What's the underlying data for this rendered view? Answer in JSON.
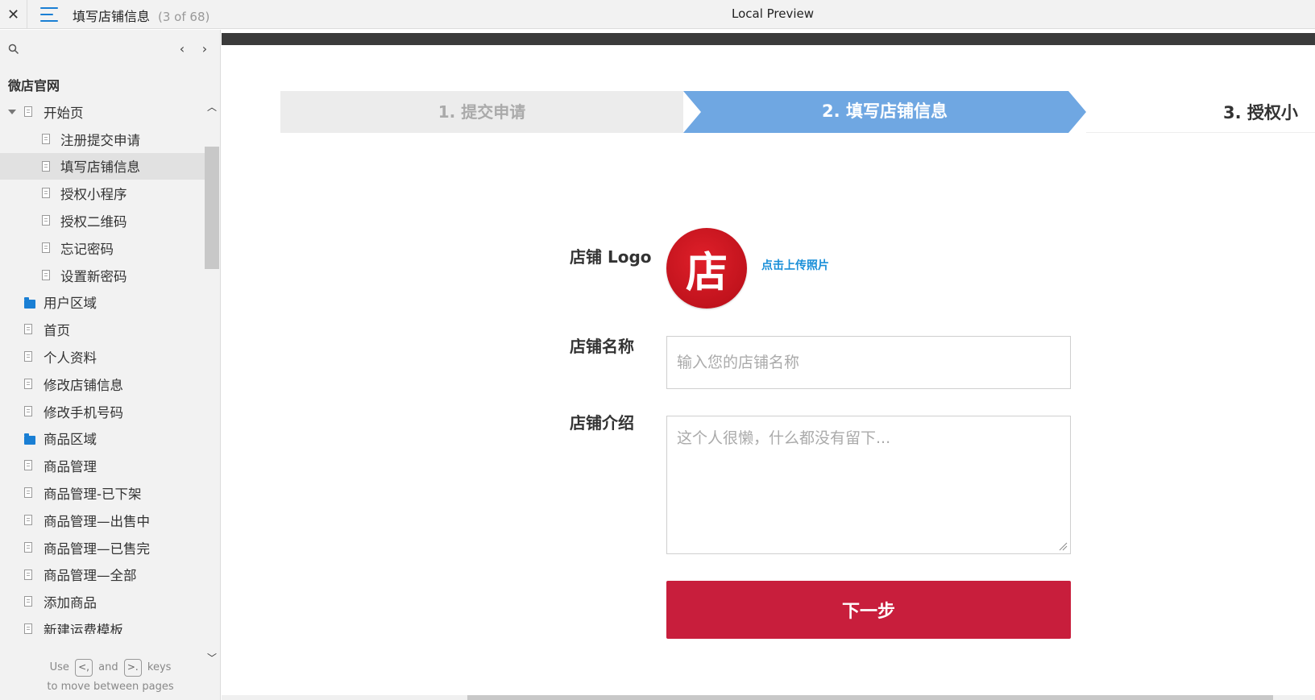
{
  "topbar": {
    "close_label": "✕",
    "title": "填写店铺信息",
    "count": "(3 of 68)",
    "preview_title": "Local Preview"
  },
  "sidebar": {
    "project_title": "微店官网",
    "items": [
      {
        "label": "开始页",
        "icon": "page-icon",
        "indent": 0,
        "caret": true
      },
      {
        "label": "注册提交申请",
        "icon": "page-icon",
        "indent": 1
      },
      {
        "label": "填写店铺信息",
        "icon": "page-icon",
        "indent": 1,
        "selected": true
      },
      {
        "label": "授权小程序",
        "icon": "page-icon",
        "indent": 1
      },
      {
        "label": "授权二维码",
        "icon": "page-icon",
        "indent": 1
      },
      {
        "label": "忘记密码",
        "icon": "page-icon",
        "indent": 1
      },
      {
        "label": "设置新密码",
        "icon": "page-icon",
        "indent": 1
      },
      {
        "label": "用户区域",
        "icon": "folder-icon",
        "indent": 0
      },
      {
        "label": "首页",
        "icon": "page-icon",
        "indent": 0
      },
      {
        "label": "个人资料",
        "icon": "page-icon",
        "indent": 0
      },
      {
        "label": "修改店铺信息",
        "icon": "page-icon",
        "indent": 0
      },
      {
        "label": "修改手机号码",
        "icon": "page-icon",
        "indent": 0
      },
      {
        "label": "商品区域",
        "icon": "folder-icon",
        "indent": 0
      },
      {
        "label": "商品管理",
        "icon": "page-icon",
        "indent": 0
      },
      {
        "label": "商品管理-已下架",
        "icon": "page-icon",
        "indent": 0
      },
      {
        "label": "商品管理—出售中",
        "icon": "page-icon",
        "indent": 0
      },
      {
        "label": "商品管理—已售完",
        "icon": "page-icon",
        "indent": 0
      },
      {
        "label": "商品管理—全部",
        "icon": "page-icon",
        "indent": 0
      },
      {
        "label": "添加商品",
        "icon": "page-icon",
        "indent": 0
      },
      {
        "label": "新建运费模板",
        "icon": "page-icon",
        "indent": 0
      }
    ],
    "hint": {
      "use": "Use",
      "key_prev": "<,",
      "and": "and",
      "key_next": ">.",
      "keys": "keys",
      "line2": "to move between pages"
    }
  },
  "steps": {
    "step1": "1. 提交申请",
    "step2": "2. 填写店铺信息",
    "step3": "3. 授权小"
  },
  "form": {
    "logo_label": "店铺 Logo",
    "logo_char": "店",
    "upload_link": "点击上传照片",
    "name_label": "店铺名称",
    "name_placeholder": "输入您的店铺名称",
    "intro_label": "店铺介绍",
    "intro_placeholder": "这个人很懒，什么都没有留下...",
    "next_button": "下一步"
  },
  "colors": {
    "accent": "#1a7fd4",
    "step_active": "#6fa7e2",
    "primary_button": "#c81e3c",
    "logo_red": "#d41a24"
  }
}
